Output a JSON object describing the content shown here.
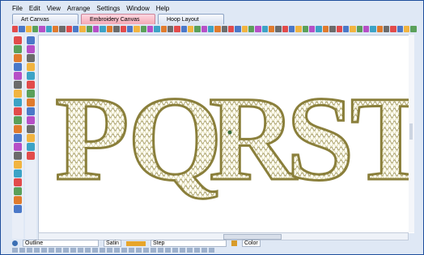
{
  "menu": [
    "File",
    "Edit",
    "View",
    "Arrange",
    "Settings",
    "Window",
    "Help"
  ],
  "tabs": [
    {
      "label": "Art Canvas",
      "active": false
    },
    {
      "label": "Embroidery Canvas",
      "active": true
    },
    {
      "label": "Hoop Layout",
      "active": false
    }
  ],
  "letters": [
    "P",
    "Q",
    "R",
    "S",
    "T"
  ],
  "status": {
    "outline_label": "Outline",
    "stitch_type_label": "Satin",
    "fill_label": "Step",
    "color_label": "Color"
  },
  "colors": {
    "thread_outline": "#8a7f3b",
    "thread_fill": "#c9bf7a",
    "accent_tab": "#f3a8b5"
  }
}
